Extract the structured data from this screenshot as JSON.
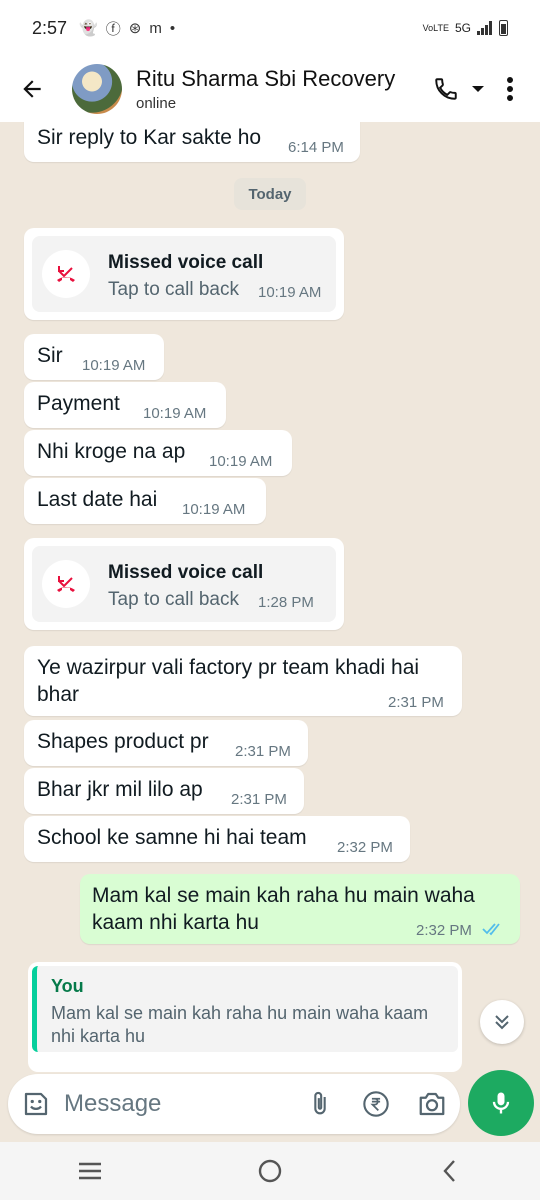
{
  "status_bar": {
    "time": "2:57",
    "network": "5G",
    "network_badge": "VoLTE"
  },
  "header": {
    "contact_name": "Ritu Sharma Sbi Recovery",
    "status": "online"
  },
  "chat": {
    "messages": [
      {
        "type": "text",
        "direction": "incoming",
        "text": "Sir reply to Kar sakte ho",
        "time": "6:14 PM"
      },
      {
        "type": "date",
        "text": "Today"
      },
      {
        "type": "missed_call",
        "direction": "incoming",
        "title": "Missed voice call",
        "subtitle": "Tap to call back",
        "time": "10:19 AM"
      },
      {
        "type": "text",
        "direction": "incoming",
        "text": "Sir",
        "time": "10:19 AM"
      },
      {
        "type": "text",
        "direction": "incoming",
        "text": "Payment",
        "time": "10:19 AM"
      },
      {
        "type": "text",
        "direction": "incoming",
        "text": "Nhi kroge na ap",
        "time": "10:19 AM"
      },
      {
        "type": "text",
        "direction": "incoming",
        "text": "Last date hai",
        "time": "10:19 AM"
      },
      {
        "type": "missed_call",
        "direction": "incoming",
        "title": "Missed voice call",
        "subtitle": "Tap to call back",
        "time": "1:28 PM"
      },
      {
        "type": "text",
        "direction": "incoming",
        "text": "Ye wazirpur vali factory pr team khadi hai bhar",
        "time": "2:31 PM"
      },
      {
        "type": "text",
        "direction": "incoming",
        "text": "Shapes product pr",
        "time": "2:31 PM"
      },
      {
        "type": "text",
        "direction": "incoming",
        "text": "Bhar jkr mil lilo ap",
        "time": "2:31 PM"
      },
      {
        "type": "text",
        "direction": "incoming",
        "text": "School ke samne hi hai team",
        "time": "2:32 PM"
      },
      {
        "type": "text",
        "direction": "outgoing",
        "text": "Mam kal se main kah raha hu main waha kaam nhi karta hu",
        "time": "2:32 PM",
        "status": "read"
      },
      {
        "type": "quote_reply",
        "direction": "incoming",
        "quoted_sender": "You",
        "quoted_text": "Mam kal se main kah raha hu main waha kaam nhi karta hu"
      }
    ]
  },
  "input_bar": {
    "placeholder": "Message"
  },
  "colors": {
    "chat_bg": "#efe7dc",
    "outgoing_bubble": "#d9fdd3",
    "incoming_bubble": "#ffffff",
    "accent_green": "#1daa61",
    "missed_call_red": "#e8103d",
    "read_tick_blue": "#53bdeb"
  },
  "icons": [
    "back-arrow-icon",
    "phone-icon",
    "dropdown-icon",
    "more-vert-icon",
    "missed-call-icon",
    "double-check-icon",
    "chevron-double-down-icon",
    "emoji-icon",
    "attach-icon",
    "rupee-icon",
    "camera-icon",
    "mic-icon",
    "nav-recent-icon",
    "nav-home-icon",
    "nav-back-icon"
  ]
}
